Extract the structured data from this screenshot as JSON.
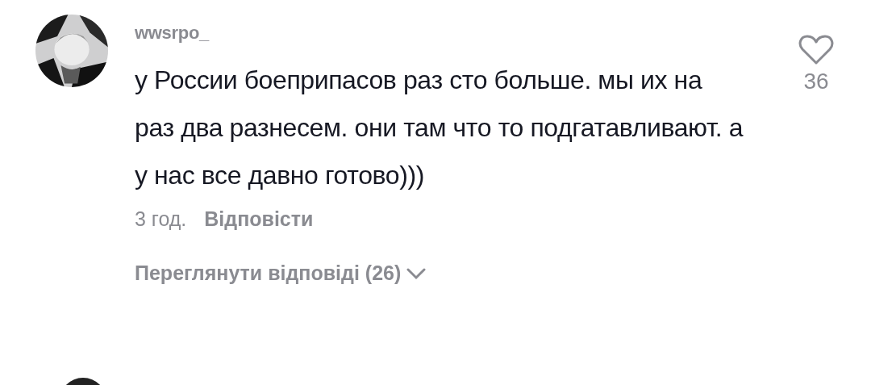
{
  "comment": {
    "username": "wwsrpo_",
    "text": "у России боеприпасов раз сто больше. мы их на раз два разнесем. они там что то подгатавливают. а у нас все давно готово)))",
    "time": "3 год.",
    "reply": "Відповісти",
    "likes": "36",
    "liked": false,
    "view_replies": "Переглянути відповіді (26)"
  }
}
